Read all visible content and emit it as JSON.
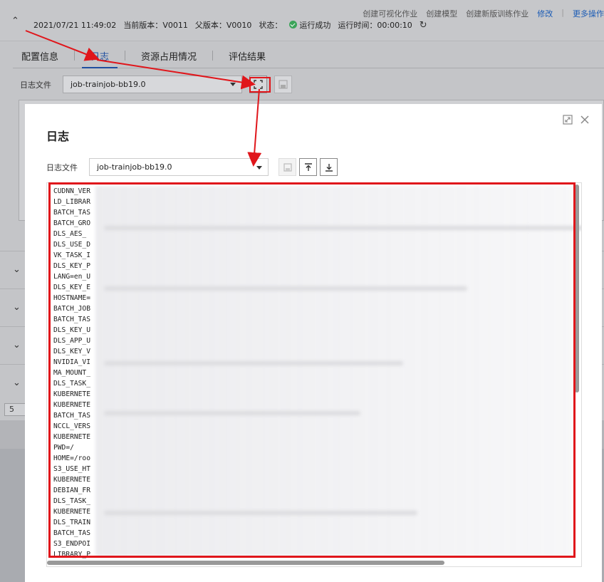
{
  "header": {
    "datetime": "2021/07/21 11:49:02",
    "current_version_label": "当前版本：",
    "current_version": "V0011",
    "parent_version_label": "父版本：",
    "parent_version": "V0010",
    "status_label": "状态：",
    "status_value": "运行成功",
    "runtime_label": "运行时间：",
    "runtime_value": "00:00:10",
    "actions": [
      "创建可视化作业",
      "创建模型",
      "创建新版训练作业"
    ],
    "modify": "修改",
    "more": "更多操作"
  },
  "tabs": [
    {
      "label": "配置信息"
    },
    {
      "label": "日志"
    },
    {
      "label": "资源占用情况"
    },
    {
      "label": "评估结果"
    }
  ],
  "bg_logfile": {
    "label": "日志文件",
    "value": "job-trainjob-bb19.0"
  },
  "pager": {
    "value": "5"
  },
  "modal": {
    "title": "日志",
    "logfile_label": "日志文件",
    "logfile_value": "job-trainjob-bb19.0",
    "log_lines": [
      "CUDNN_VER",
      "LD_LIBRAR",
      "BATCH_TAS",
      "BATCH_GRO",
      "DLS_AES_",
      "DLS_USE_D",
      "VK_TASK_I",
      "DLS_KEY_P",
      "LANG=en_U",
      "DLS_KEY_E",
      "HOSTNAME=",
      "BATCH_JOB",
      "BATCH_TAS",
      "DLS_KEY_U",
      "DLS_APP_U",
      "DLS_KEY_V",
      "NVIDIA_VI",
      "MA_MOUNT_",
      "DLS_TASK_",
      "KUBERNETE",
      "KUBERNETE",
      "BATCH_TAS",
      "NCCL_VERS",
      "KUBERNETE",
      "PWD=/",
      "HOME=/roo",
      "S3_USE_HT",
      "KUBERNETE",
      "DEBIAN_FR",
      "DLS_TASK_",
      "KUBERNETE",
      "DLS_TRAIN",
      "BATCH_TAS",
      "S3_ENDPOI",
      "LIBRARY_P"
    ]
  },
  "colors": {
    "accent": "#1f4fa0",
    "annotation_red": "#e0161b",
    "success": "#3ca45a"
  }
}
